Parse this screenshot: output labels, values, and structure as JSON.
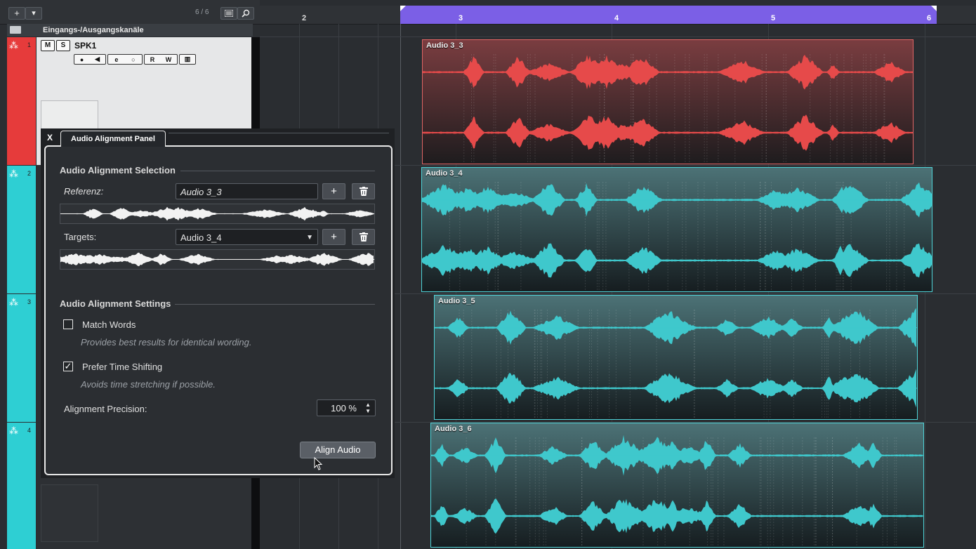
{
  "toolbar": {
    "add_label": "+",
    "dropdown_label": "▾",
    "track_count": "6 / 6"
  },
  "io_channels": {
    "label": "Eingangs-/Ausgangskanäle"
  },
  "tracks": [
    {
      "number": "1",
      "name": "SPK1",
      "color": "#e63b3b"
    },
    {
      "number": "2",
      "color": "#2ecfd3"
    },
    {
      "number": "3",
      "color": "#2ecfd3"
    },
    {
      "number": "4",
      "color": "#2ecfd3"
    }
  ],
  "track1_controls": {
    "mute": "M",
    "solo": "S",
    "edit": "e",
    "monitor": "○",
    "read": "R",
    "write": "W"
  },
  "ruler": {
    "bars": [
      "2",
      "3",
      "4",
      "5",
      "6"
    ],
    "cycle_color": "#7b5fe6"
  },
  "events": [
    {
      "name": "Audio 3_3",
      "color": "#e64a4a"
    },
    {
      "name": "Audio 3_4",
      "color": "#3fc8cc"
    },
    {
      "name": "Audio 3_5",
      "color": "#3fc8cc"
    },
    {
      "name": "Audio 3_6",
      "color": "#3fc8cc"
    }
  ],
  "panel": {
    "close_label": "X",
    "tab_label": "Audio Alignment Panel",
    "selection_heading": "Audio Alignment Selection",
    "reference_label": "Referenz:",
    "reference_value": "Audio 3_3",
    "targets_label": "Targets:",
    "targets_value": "Audio 3_4",
    "add_label": "+",
    "settings_heading": "Audio Alignment Settings",
    "match_words_label": "Match Words",
    "match_words_checked": false,
    "match_words_hint": "Provides best results for identical wording.",
    "prefer_time_shifting_label": "Prefer Time Shifting",
    "prefer_time_shifting_checked": true,
    "prefer_time_shifting_hint": "Avoids time stretching if possible.",
    "precision_label": "Alignment Precision:",
    "precision_value": "100 %",
    "align_button": "Align Audio"
  }
}
